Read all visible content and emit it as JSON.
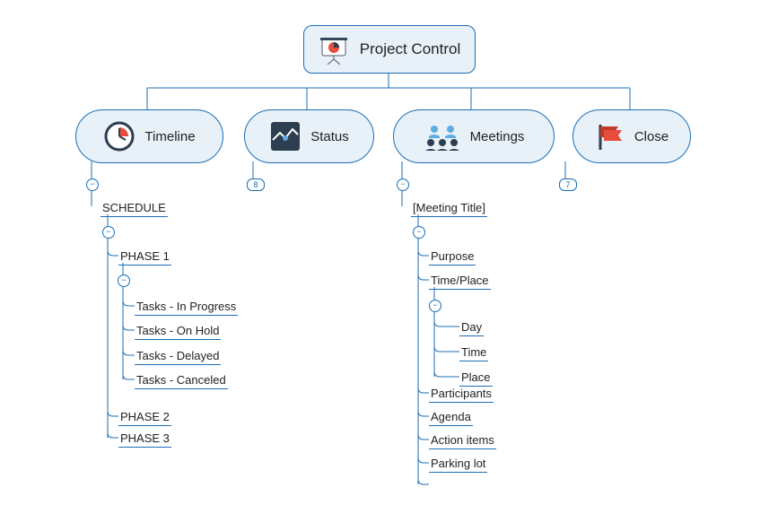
{
  "root": {
    "label": "Project Control",
    "icon": "presentation-icon"
  },
  "categories": [
    {
      "key": "timeline",
      "label": "Timeline",
      "icon": "clock-icon"
    },
    {
      "key": "status",
      "label": "Status",
      "icon": "status-icon",
      "badge": "8"
    },
    {
      "key": "meetings",
      "label": "Meetings",
      "icon": "people-icon"
    },
    {
      "key": "close",
      "label": "Close",
      "icon": "flag-icon",
      "badge": "7"
    }
  ],
  "timeline": {
    "schedule": "SCHEDULE",
    "phase1": {
      "label": "PHASE 1",
      "tasks": [
        "Tasks - In Progress",
        "Tasks - On Hold",
        "Tasks - Delayed",
        "Tasks - Canceled"
      ]
    },
    "phase2": "PHASE 2",
    "phase3": "PHASE 3"
  },
  "meetings": {
    "title": "[Meeting Title]",
    "items": {
      "purpose": "Purpose",
      "timeplace": {
        "label": "Time/Place",
        "sub": {
          "day": "Day",
          "time": "Time",
          "place": "Place"
        }
      },
      "participants": "Participants",
      "agenda": "Agenda",
      "action": "Action items",
      "parking": "Parking lot"
    }
  }
}
